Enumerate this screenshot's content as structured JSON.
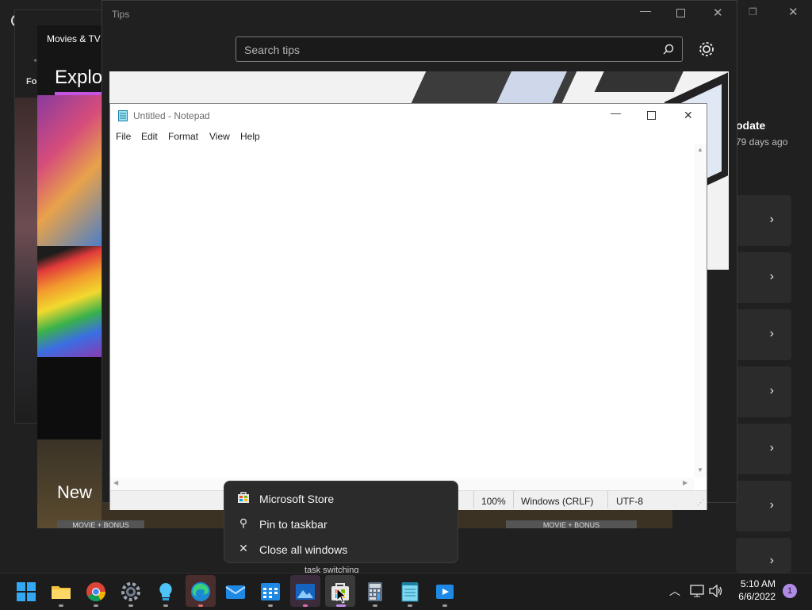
{
  "settings": {
    "update_title": "odate",
    "update_sub": "79 days ago"
  },
  "movies": {
    "title": "Movies & TV",
    "explore": "Explor",
    "new": "New",
    "for": "Fo",
    "banner_left": "MOVIE + BONUS",
    "banner_right": "MOVIE + BONUS"
  },
  "tips": {
    "title": "Tips",
    "search_placeholder": "Search tips"
  },
  "notepad": {
    "title": "Untitled - Notepad",
    "menu": [
      "File",
      "Edit",
      "Format",
      "View",
      "Help"
    ],
    "status": {
      "zoom": "100%",
      "line_ending": "Windows (CRLF)",
      "encoding": "UTF-8"
    }
  },
  "context_menu": {
    "items": [
      "Microsoft Store",
      "Pin to taskbar",
      "Close all windows"
    ]
  },
  "behind_text": "task switching",
  "taskbar": {
    "time": "5:10 AM",
    "date": "6/6/2022",
    "notification_count": "1",
    "icons": [
      "start-icon",
      "file-explorer-icon",
      "chrome-icon",
      "settings-icon",
      "tips-icon",
      "edge-icon",
      "mail-icon",
      "calendar-icon",
      "photos-icon",
      "store-icon",
      "calculator-icon",
      "notepad-icon",
      "movies-tv-icon"
    ]
  },
  "colors": {
    "accent": "#0a84d8",
    "notification": "#b18ae8",
    "taskbar": "#1c1c1c"
  }
}
